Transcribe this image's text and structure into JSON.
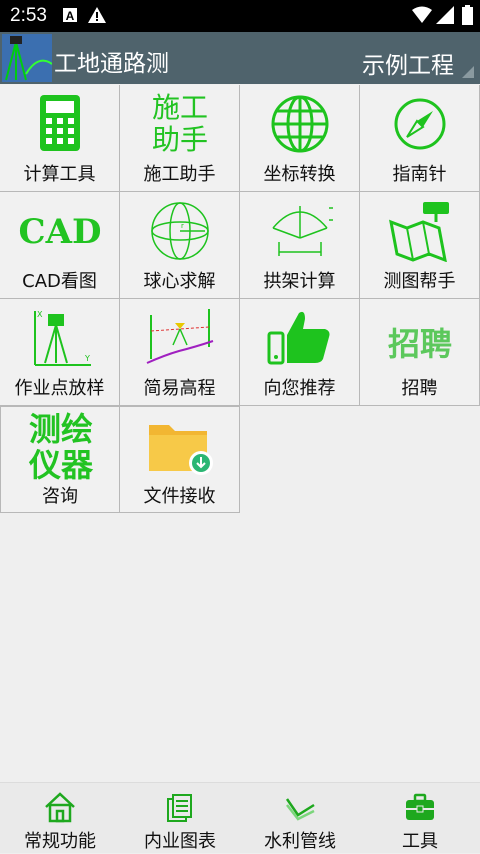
{
  "status": {
    "time": "2:53"
  },
  "header": {
    "title": "工地通路测",
    "project": "示例工程"
  },
  "tools": [
    {
      "label": "计算工具",
      "icon": "calculator-icon"
    },
    {
      "label": "施工助手",
      "icon": "construction-assistant-icon",
      "icon_text": [
        "施工",
        "助手"
      ]
    },
    {
      "label": "坐标转换",
      "icon": "globe-icon"
    },
    {
      "label": "指南针",
      "icon": "compass-icon"
    },
    {
      "label": "CAD看图",
      "icon": "cad-icon",
      "icon_text": [
        "CAD"
      ]
    },
    {
      "label": "球心求解",
      "icon": "sphere-icon"
    },
    {
      "label": "拱架计算",
      "icon": "arch-icon"
    },
    {
      "label": "测图帮手",
      "icon": "map-helper-icon"
    },
    {
      "label": "作业点放样",
      "icon": "stakeout-icon"
    },
    {
      "label": "简易高程",
      "icon": "elevation-icon"
    },
    {
      "label": "向您推荐",
      "icon": "thumbs-up-icon"
    },
    {
      "label": "招聘",
      "icon": "recruit-icon",
      "icon_text": [
        "招聘"
      ]
    },
    {
      "label": "咨询",
      "icon": "instrument-icon",
      "icon_text": [
        "测绘",
        "仪器"
      ]
    },
    {
      "label": "文件接收",
      "icon": "folder-download-icon"
    }
  ],
  "nav": [
    {
      "label": "常规功能",
      "icon": "home-icon"
    },
    {
      "label": "内业图表",
      "icon": "documents-icon"
    },
    {
      "label": "水利管线",
      "icon": "pipeline-icon"
    },
    {
      "label": "工具",
      "icon": "toolbox-icon"
    }
  ],
  "colors": {
    "accent": "#22c322",
    "appbar": "#4f636c",
    "grid_border": "#b8b8b8"
  }
}
